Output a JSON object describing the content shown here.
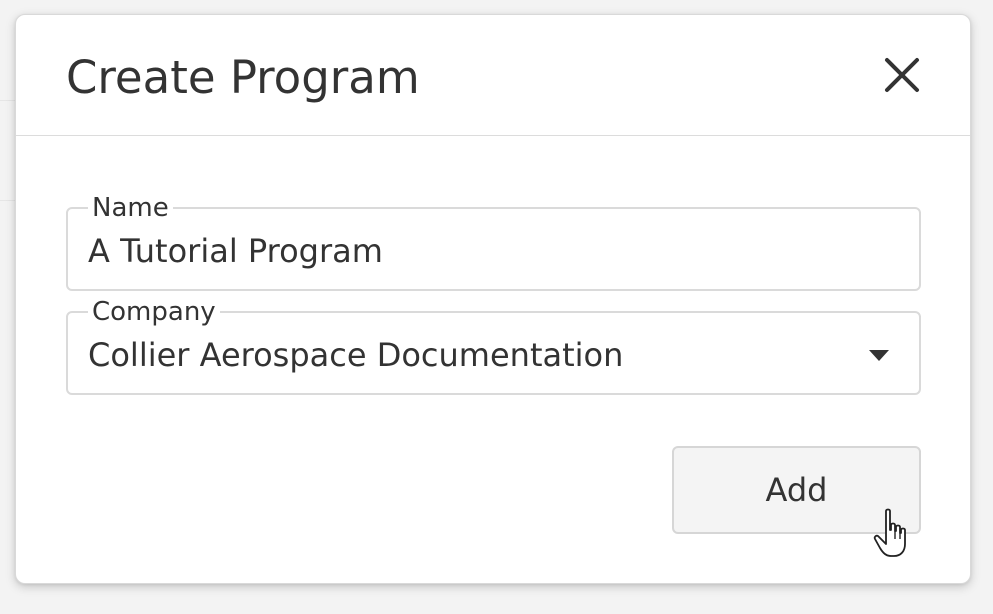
{
  "dialog": {
    "title": "Create Program",
    "close_icon": "close-icon"
  },
  "form": {
    "name": {
      "label": "Name",
      "value": "A Tutorial Program"
    },
    "company": {
      "label": "Company",
      "value": "Collier Aerospace Documentation",
      "dropdown_icon": "caret-down-icon"
    }
  },
  "actions": {
    "add_label": "Add"
  },
  "cursor_icon": "hand-pointer-icon"
}
